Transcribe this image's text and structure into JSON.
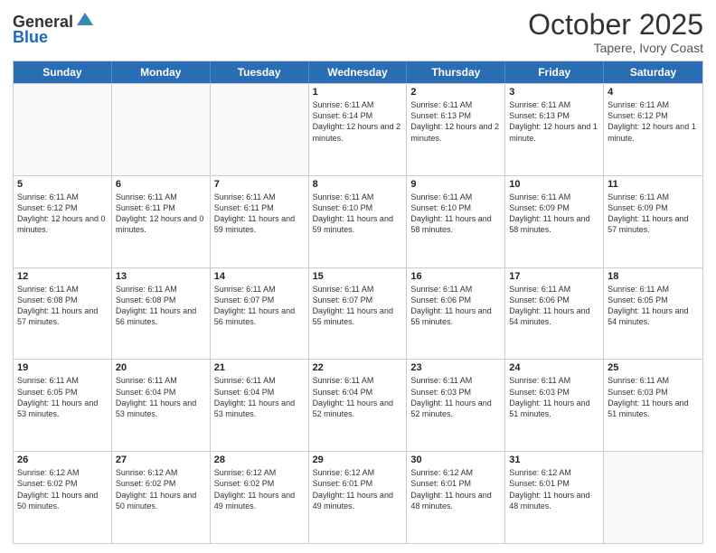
{
  "header": {
    "logo_general": "General",
    "logo_blue": "Blue",
    "month_title": "October 2025",
    "location": "Tapere, Ivory Coast"
  },
  "days_of_week": [
    "Sunday",
    "Monday",
    "Tuesday",
    "Wednesday",
    "Thursday",
    "Friday",
    "Saturday"
  ],
  "weeks": [
    [
      {
        "day": "",
        "info": ""
      },
      {
        "day": "",
        "info": ""
      },
      {
        "day": "",
        "info": ""
      },
      {
        "day": "1",
        "info": "Sunrise: 6:11 AM\nSunset: 6:14 PM\nDaylight: 12 hours and 2 minutes."
      },
      {
        "day": "2",
        "info": "Sunrise: 6:11 AM\nSunset: 6:13 PM\nDaylight: 12 hours and 2 minutes."
      },
      {
        "day": "3",
        "info": "Sunrise: 6:11 AM\nSunset: 6:13 PM\nDaylight: 12 hours and 1 minute."
      },
      {
        "day": "4",
        "info": "Sunrise: 6:11 AM\nSunset: 6:12 PM\nDaylight: 12 hours and 1 minute."
      }
    ],
    [
      {
        "day": "5",
        "info": "Sunrise: 6:11 AM\nSunset: 6:12 PM\nDaylight: 12 hours and 0 minutes."
      },
      {
        "day": "6",
        "info": "Sunrise: 6:11 AM\nSunset: 6:11 PM\nDaylight: 12 hours and 0 minutes."
      },
      {
        "day": "7",
        "info": "Sunrise: 6:11 AM\nSunset: 6:11 PM\nDaylight: 11 hours and 59 minutes."
      },
      {
        "day": "8",
        "info": "Sunrise: 6:11 AM\nSunset: 6:10 PM\nDaylight: 11 hours and 59 minutes."
      },
      {
        "day": "9",
        "info": "Sunrise: 6:11 AM\nSunset: 6:10 PM\nDaylight: 11 hours and 58 minutes."
      },
      {
        "day": "10",
        "info": "Sunrise: 6:11 AM\nSunset: 6:09 PM\nDaylight: 11 hours and 58 minutes."
      },
      {
        "day": "11",
        "info": "Sunrise: 6:11 AM\nSunset: 6:09 PM\nDaylight: 11 hours and 57 minutes."
      }
    ],
    [
      {
        "day": "12",
        "info": "Sunrise: 6:11 AM\nSunset: 6:08 PM\nDaylight: 11 hours and 57 minutes."
      },
      {
        "day": "13",
        "info": "Sunrise: 6:11 AM\nSunset: 6:08 PM\nDaylight: 11 hours and 56 minutes."
      },
      {
        "day": "14",
        "info": "Sunrise: 6:11 AM\nSunset: 6:07 PM\nDaylight: 11 hours and 56 minutes."
      },
      {
        "day": "15",
        "info": "Sunrise: 6:11 AM\nSunset: 6:07 PM\nDaylight: 11 hours and 55 minutes."
      },
      {
        "day": "16",
        "info": "Sunrise: 6:11 AM\nSunset: 6:06 PM\nDaylight: 11 hours and 55 minutes."
      },
      {
        "day": "17",
        "info": "Sunrise: 6:11 AM\nSunset: 6:06 PM\nDaylight: 11 hours and 54 minutes."
      },
      {
        "day": "18",
        "info": "Sunrise: 6:11 AM\nSunset: 6:05 PM\nDaylight: 11 hours and 54 minutes."
      }
    ],
    [
      {
        "day": "19",
        "info": "Sunrise: 6:11 AM\nSunset: 6:05 PM\nDaylight: 11 hours and 53 minutes."
      },
      {
        "day": "20",
        "info": "Sunrise: 6:11 AM\nSunset: 6:04 PM\nDaylight: 11 hours and 53 minutes."
      },
      {
        "day": "21",
        "info": "Sunrise: 6:11 AM\nSunset: 6:04 PM\nDaylight: 11 hours and 53 minutes."
      },
      {
        "day": "22",
        "info": "Sunrise: 6:11 AM\nSunset: 6:04 PM\nDaylight: 11 hours and 52 minutes."
      },
      {
        "day": "23",
        "info": "Sunrise: 6:11 AM\nSunset: 6:03 PM\nDaylight: 11 hours and 52 minutes."
      },
      {
        "day": "24",
        "info": "Sunrise: 6:11 AM\nSunset: 6:03 PM\nDaylight: 11 hours and 51 minutes."
      },
      {
        "day": "25",
        "info": "Sunrise: 6:11 AM\nSunset: 6:03 PM\nDaylight: 11 hours and 51 minutes."
      }
    ],
    [
      {
        "day": "26",
        "info": "Sunrise: 6:12 AM\nSunset: 6:02 PM\nDaylight: 11 hours and 50 minutes."
      },
      {
        "day": "27",
        "info": "Sunrise: 6:12 AM\nSunset: 6:02 PM\nDaylight: 11 hours and 50 minutes."
      },
      {
        "day": "28",
        "info": "Sunrise: 6:12 AM\nSunset: 6:02 PM\nDaylight: 11 hours and 49 minutes."
      },
      {
        "day": "29",
        "info": "Sunrise: 6:12 AM\nSunset: 6:01 PM\nDaylight: 11 hours and 49 minutes."
      },
      {
        "day": "30",
        "info": "Sunrise: 6:12 AM\nSunset: 6:01 PM\nDaylight: 11 hours and 48 minutes."
      },
      {
        "day": "31",
        "info": "Sunrise: 6:12 AM\nSunset: 6:01 PM\nDaylight: 11 hours and 48 minutes."
      },
      {
        "day": "",
        "info": ""
      }
    ]
  ]
}
